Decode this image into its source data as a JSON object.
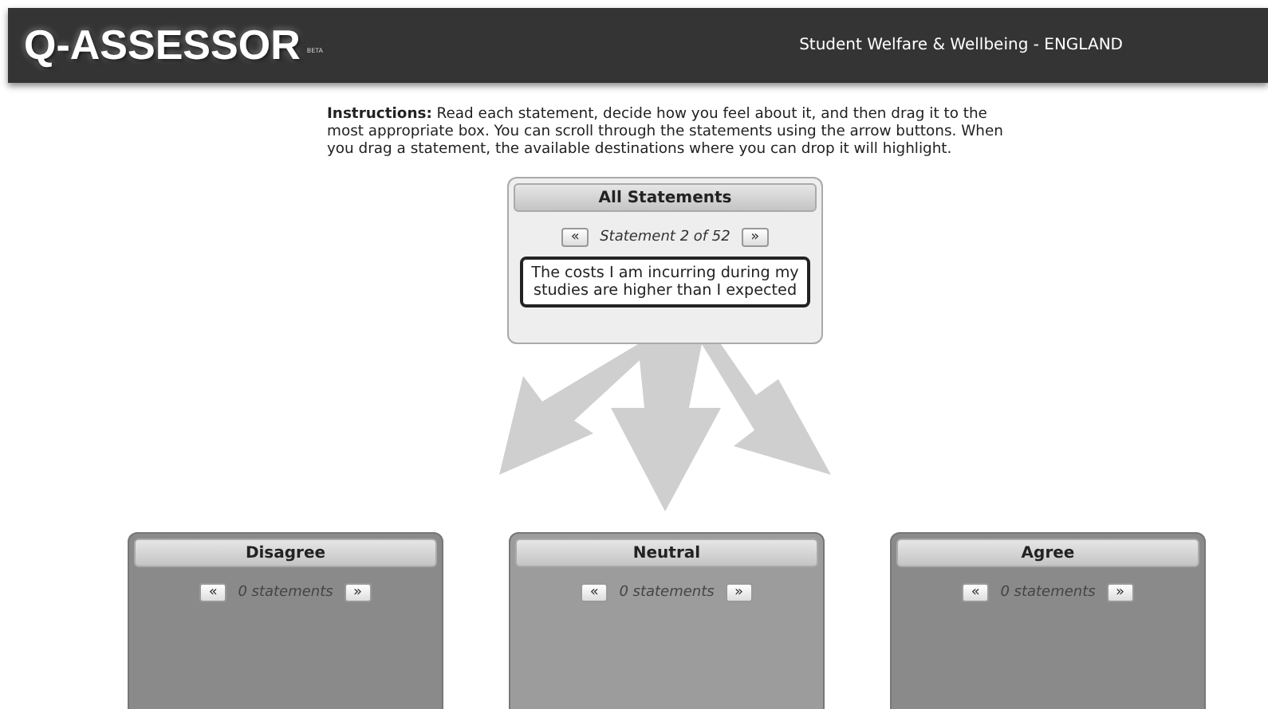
{
  "header": {
    "logo": "Q-ASSESSOR",
    "badge": "BETA",
    "subtitle": "Student Welfare & Wellbeing - ENGLAND"
  },
  "instructions": "**Instructions:** Read each statement, decide how you feel about it, and then drag it to the most appropriate box. You can scroll through the statements using the arrow buttons. When you drag a statement, the available destinations where you can drop it will highlight.",
  "source": {
    "title": "All Statements",
    "prev": "«",
    "next": "»",
    "counter": "Statement 2 of 52",
    "statement": "The costs I am incurring during my studies are higher than I expected"
  },
  "bins": [
    {
      "title": "Disagree",
      "prev": "«",
      "next": "»",
      "counter": "0 statements",
      "color": "#8a8a8a"
    },
    {
      "title": "Neutral",
      "prev": "«",
      "next": "»",
      "counter": "0 statements",
      "color": "#9c9c9c"
    },
    {
      "title": "Agree",
      "prev": "«",
      "next": "»",
      "counter": "0 statements",
      "color": "#8a8a8a"
    }
  ]
}
